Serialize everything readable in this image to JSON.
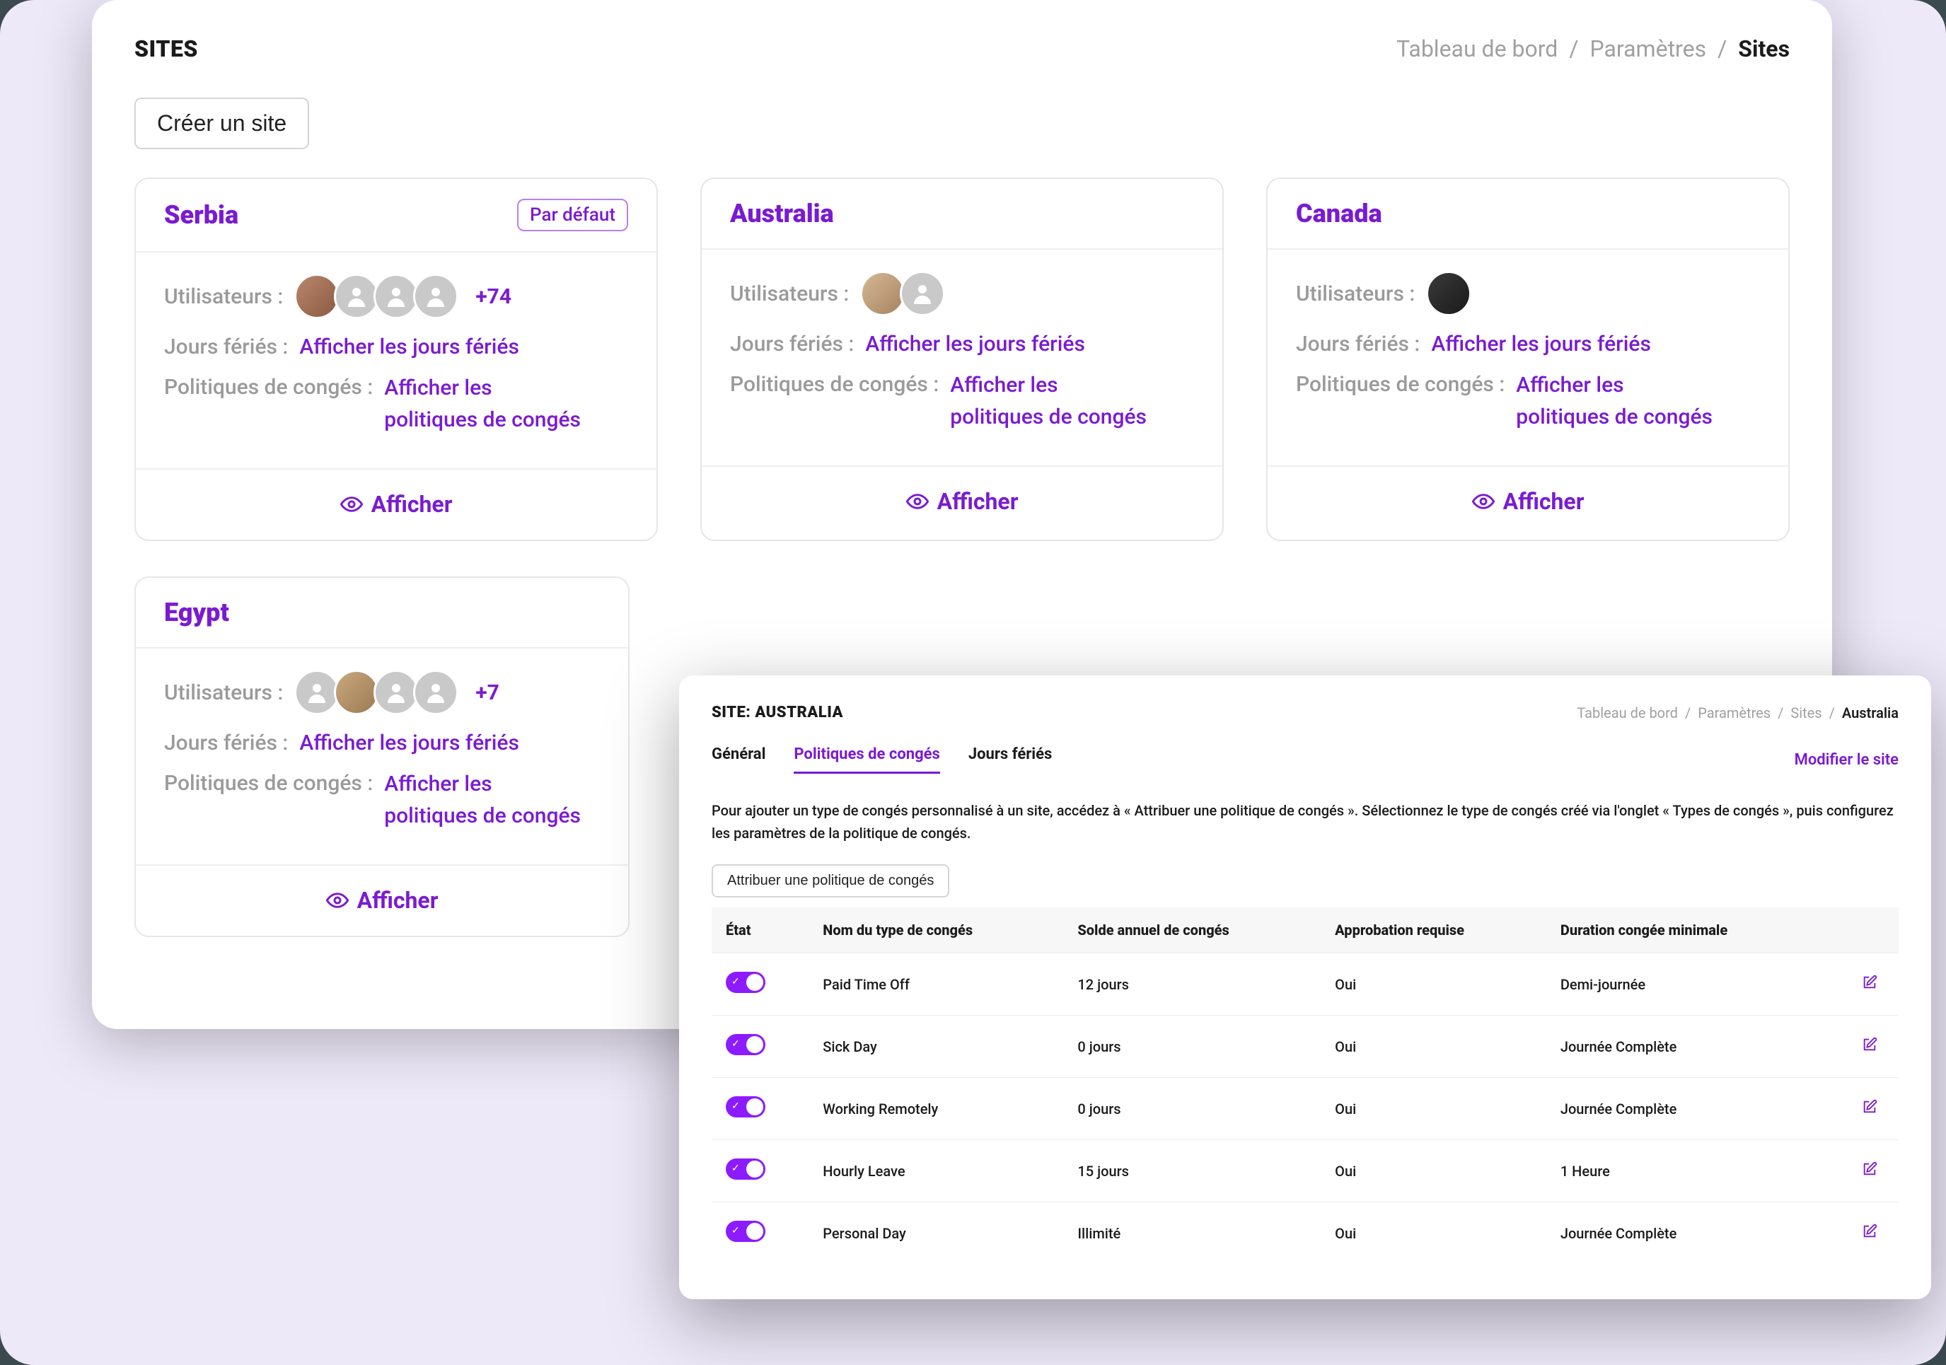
{
  "header": {
    "title": "SITES",
    "breadcrumb": [
      "Tableau de bord",
      "Paramètres",
      "Sites"
    ],
    "create_button": "Créer un site"
  },
  "labels": {
    "users": "Utilisateurs :",
    "holidays": "Jours fériés :",
    "holidays_link": "Afficher les jours fériés",
    "policies": "Politiques de congés :",
    "policies_link": "Afficher les politiques de congés",
    "view": "Afficher",
    "default": "Par défaut"
  },
  "sites": [
    {
      "name": "Serbia",
      "is_default": true,
      "overflow": "+74",
      "avatars": [
        "photo1",
        "generic",
        "generic",
        "generic"
      ]
    },
    {
      "name": "Australia",
      "is_default": false,
      "overflow": "",
      "avatars": [
        "photo2",
        "generic"
      ]
    },
    {
      "name": "Canada",
      "is_default": false,
      "overflow": "",
      "avatars": [
        "photo3"
      ]
    },
    {
      "name": "Egypt",
      "is_default": false,
      "overflow": "+7",
      "avatars": [
        "generic",
        "photo4",
        "generic",
        "generic"
      ]
    }
  ],
  "detail": {
    "title": "SITE: AUSTRALIA",
    "breadcrumb": [
      "Tableau de bord",
      "Paramètres",
      "Sites",
      "Australia"
    ],
    "tabs": [
      "Général",
      "Politiques de congés",
      "Jours fériés"
    ],
    "active_tab": 1,
    "modify": "Modifier le site",
    "help": "Pour ajouter un type de congés personnalisé à un site, accédez à « Attribuer une politique de congés ». Sélectionnez le type de congés créé via l'onglet « Types de congés », puis configurez les paramètres de la politique de congés.",
    "assign_button": "Attribuer une politique de congés",
    "columns": [
      "État",
      "Nom du type de congés",
      "Solde annuel de congés",
      "Approbation requise",
      "Duration congée minimale"
    ],
    "rows": [
      {
        "enabled": true,
        "name": "Paid Time Off",
        "balance": "12 jours",
        "approval": "Oui",
        "min": "Demi-journée"
      },
      {
        "enabled": true,
        "name": "Sick Day",
        "balance": "0 jours",
        "approval": "Oui",
        "min": "Journée Complète"
      },
      {
        "enabled": true,
        "name": "Working Remotely",
        "balance": "0 jours",
        "approval": "Oui",
        "min": "Journée Complète"
      },
      {
        "enabled": true,
        "name": "Hourly Leave",
        "balance": "15 jours",
        "approval": "Oui",
        "min": "1 Heure"
      },
      {
        "enabled": true,
        "name": "Personal Day",
        "balance": "Illimité",
        "approval": "Oui",
        "min": "Journée Complète"
      }
    ]
  }
}
